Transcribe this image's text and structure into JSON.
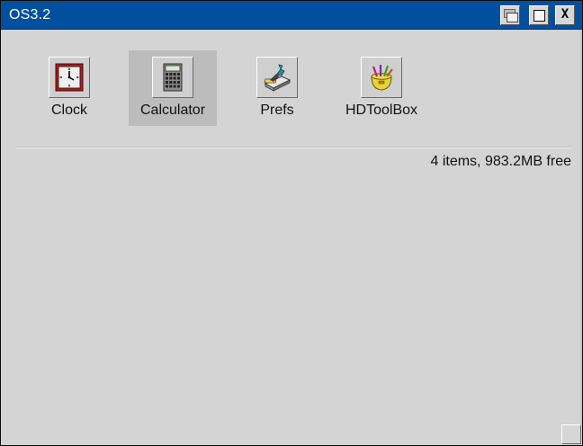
{
  "window": {
    "title": "OS3.2",
    "buttons": {
      "depth_icon": "depth-arrange-icon",
      "zoom_icon": "zoom-icon",
      "close_label": "X"
    }
  },
  "icons": [
    {
      "label": "Clock",
      "icon": "clock-icon",
      "selected": false
    },
    {
      "label": "Calculator",
      "icon": "calculator-icon",
      "selected": true
    },
    {
      "label": "Prefs",
      "icon": "prefs-icon",
      "selected": false
    },
    {
      "label": "HDToolBox",
      "icon": "hdtoolbox-icon",
      "selected": false
    }
  ],
  "status": {
    "text": "4 items, 983.2MB free"
  },
  "colors": {
    "titlebar": "#0050a0",
    "background": "#d4d4d4",
    "selection": "#bcbcbc"
  }
}
